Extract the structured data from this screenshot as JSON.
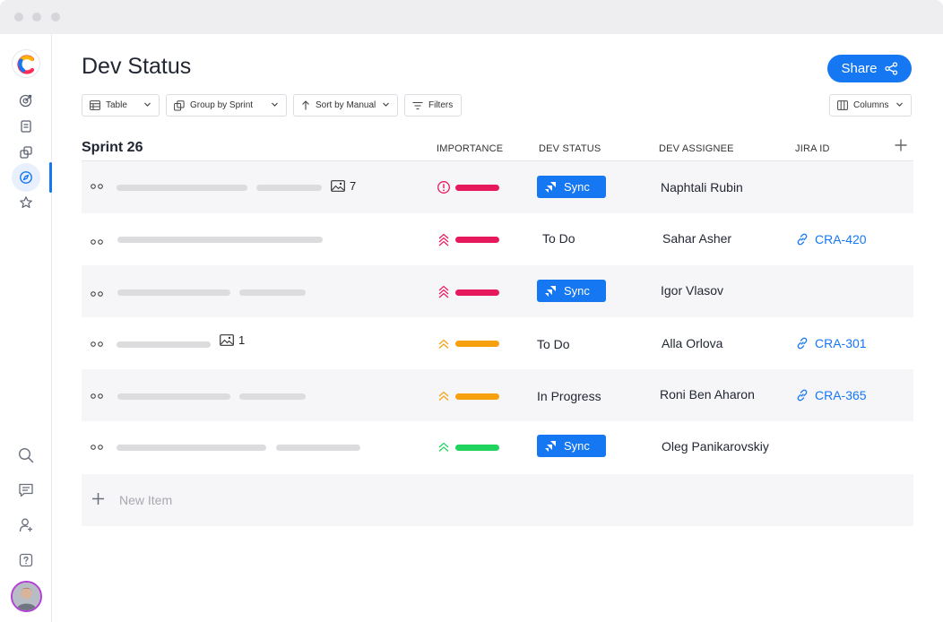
{
  "page": {
    "title": "Dev Status"
  },
  "share": {
    "label": "Share"
  },
  "toolbar": {
    "view": "Table",
    "group_by": "Group by Sprint",
    "sort_by": "Sort by Manual",
    "filters": "Filters",
    "columns": "Columns"
  },
  "table": {
    "group_title": "Sprint 26",
    "columns": [
      "IMPORTANCE",
      "DEV STATUS",
      "DEV ASSIGNEE",
      "JIRA ID"
    ],
    "rows": [
      {
        "image_count": "7",
        "importance": "critical",
        "importance_color": "#e5195c",
        "dev_status": "Sync",
        "status_is_sync": true,
        "assignee": "Naphtali Rubin",
        "jira_id": ""
      },
      {
        "image_count": "",
        "importance": "highest",
        "importance_color": "#e5195c",
        "dev_status": "To Do",
        "status_is_sync": false,
        "assignee": "Sahar Asher",
        "jira_id": "CRA-420"
      },
      {
        "image_count": "",
        "importance": "highest",
        "importance_color": "#e5195c",
        "dev_status": "Sync",
        "status_is_sync": true,
        "assignee": "Igor Vlasov",
        "jira_id": ""
      },
      {
        "image_count": "1",
        "importance": "high",
        "importance_color": "#f5a00c",
        "dev_status": "To Do",
        "status_is_sync": false,
        "assignee": "Alla Orlova",
        "jira_id": "CRA-301"
      },
      {
        "image_count": "",
        "importance": "high",
        "importance_color": "#f5a00c",
        "dev_status": "In Progress",
        "status_is_sync": false,
        "assignee": "Roni Ben Aharon",
        "jira_id": "CRA-365"
      },
      {
        "image_count": "",
        "importance": "low",
        "importance_color": "#1fd35d",
        "dev_status": "Sync",
        "status_is_sync": true,
        "assignee": "Oleg Panikarovskiy",
        "jira_id": ""
      }
    ],
    "new_item": "New Item"
  },
  "colors": {
    "accent": "#1677f2",
    "critical": "#e5195c",
    "medium": "#f5a00c",
    "low": "#1fd35d"
  }
}
